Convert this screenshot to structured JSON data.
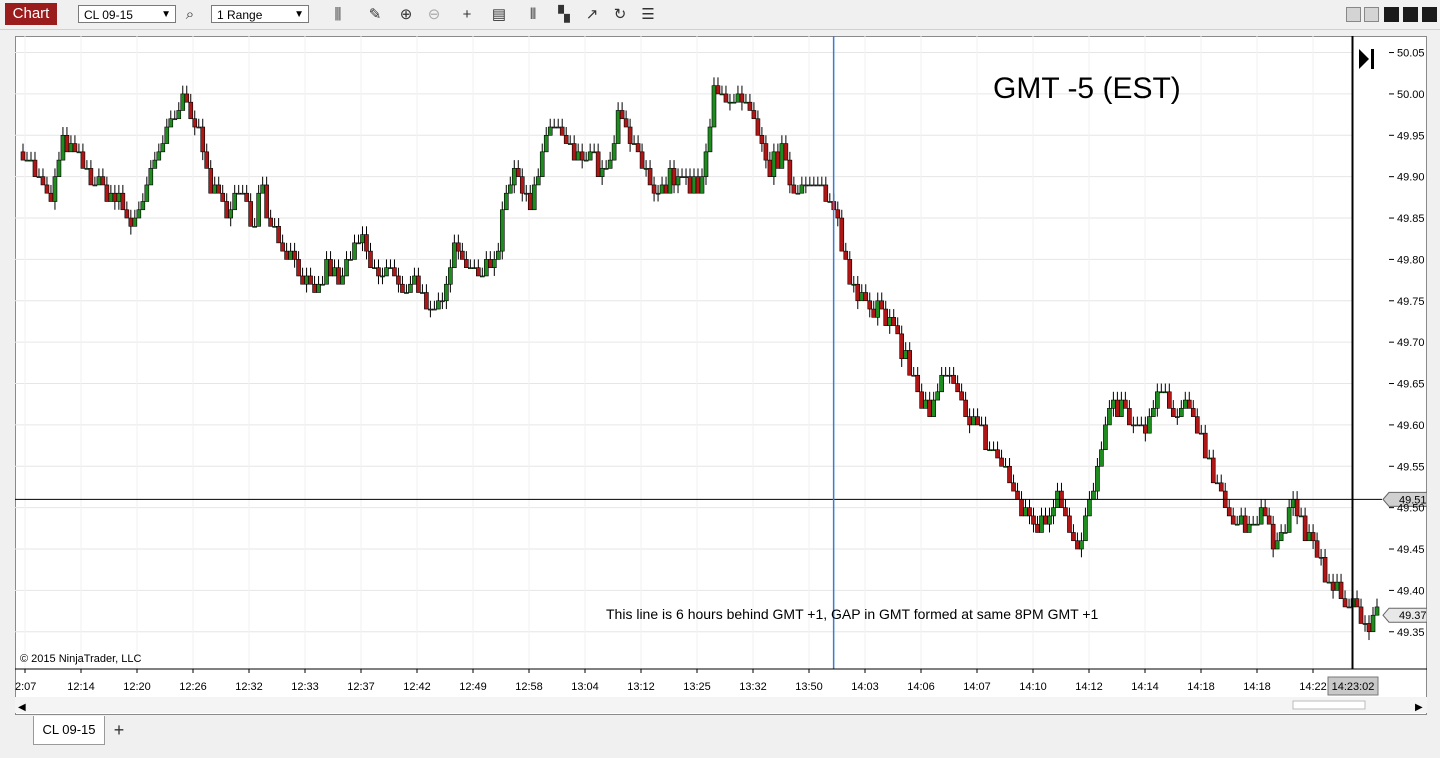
{
  "toolbar": {
    "chart_label": "Chart",
    "instrument": "CL 09-15",
    "interval": "1 Range",
    "icons": [
      "search-icon",
      "bar-style-icon",
      "pencil-icon",
      "zoom-in-icon",
      "zoom-out-icon",
      "crosshair-icon",
      "data-box-icon",
      "indicators-icon",
      "strategies-icon",
      "drawing-tools-icon",
      "refresh-icon",
      "properties-icon"
    ]
  },
  "window_controls": [
    "minimize",
    "maximize",
    "restore",
    "close"
  ],
  "tabs": {
    "active": "CL 09-15",
    "add_label": "+"
  },
  "chart_data": {
    "type": "candlestick",
    "annotation_title": "GMT -5  (EST)",
    "note": "This line is 6 hours behind GMT +1, GAP in GMT formed at same 8PM GMT +1",
    "copyright": "© 2015 NinjaTrader, LLC",
    "ylim": [
      49.305,
      50.07
    ],
    "y_ticks": [
      "50.05",
      "50.00",
      "49.95",
      "49.90",
      "49.85",
      "49.80",
      "49.75",
      "49.70",
      "49.65",
      "49.60",
      "49.55",
      "49.50",
      "49.45",
      "49.40",
      "49.35"
    ],
    "x_ticks": [
      "2:07",
      "12:14",
      "12:20",
      "12:26",
      "12:32",
      "12:33",
      "12:37",
      "12:42",
      "12:49",
      "12:58",
      "13:04",
      "13:12",
      "13:25",
      "13:32",
      "13:50",
      "14:03",
      "14:06",
      "14:07",
      "14:10",
      "14:12",
      "14:14",
      "14:18",
      "14:18",
      "14:22"
    ],
    "x_cursor_label": "14:23:02",
    "horizontal_line": {
      "value": 49.51,
      "label": "49.51"
    },
    "last_price": {
      "value": 49.37,
      "label": "49.37"
    },
    "vertical_marker_index": 0.5987,
    "close_path": [
      [
        0,
        49.93
      ],
      [
        0.02,
        49.87
      ],
      [
        0.03,
        49.94
      ],
      [
        0.045,
        49.91
      ],
      [
        0.06,
        49.88
      ],
      [
        0.07,
        49.87
      ],
      [
        0.08,
        49.84
      ],
      [
        0.095,
        49.9
      ],
      [
        0.105,
        49.95
      ],
      [
        0.115,
        49.98
      ],
      [
        0.12,
        50.0
      ],
      [
        0.13,
        49.95
      ],
      [
        0.14,
        49.88
      ],
      [
        0.15,
        49.86
      ],
      [
        0.16,
        49.88
      ],
      [
        0.17,
        49.84
      ],
      [
        0.175,
        49.9
      ],
      [
        0.18,
        49.86
      ],
      [
        0.19,
        49.82
      ],
      [
        0.2,
        49.8
      ],
      [
        0.21,
        49.77
      ],
      [
        0.215,
        49.75
      ],
      [
        0.225,
        49.79
      ],
      [
        0.235,
        49.77
      ],
      [
        0.24,
        49.8
      ],
      [
        0.25,
        49.82
      ],
      [
        0.26,
        49.78
      ],
      [
        0.27,
        49.79
      ],
      [
        0.28,
        49.76
      ],
      [
        0.29,
        49.78
      ],
      [
        0.3,
        49.72
      ],
      [
        0.31,
        49.76
      ],
      [
        0.32,
        49.83
      ],
      [
        0.33,
        49.78
      ],
      [
        0.34,
        49.79
      ],
      [
        0.35,
        49.8
      ],
      [
        0.355,
        49.88
      ],
      [
        0.365,
        49.9
      ],
      [
        0.375,
        49.87
      ],
      [
        0.385,
        49.93
      ],
      [
        0.39,
        49.97
      ],
      [
        0.4,
        49.94
      ],
      [
        0.41,
        49.92
      ],
      [
        0.42,
        49.93
      ],
      [
        0.43,
        49.89
      ],
      [
        0.44,
        49.97
      ],
      [
        0.45,
        49.94
      ],
      [
        0.46,
        49.9
      ],
      [
        0.47,
        49.88
      ],
      [
        0.48,
        49.9
      ],
      [
        0.49,
        49.89
      ],
      [
        0.5,
        49.88
      ],
      [
        0.505,
        49.93
      ],
      [
        0.51,
        50.02
      ],
      [
        0.52,
        49.98
      ],
      [
        0.53,
        49.99
      ],
      [
        0.54,
        49.96
      ],
      [
        0.55,
        49.91
      ],
      [
        0.56,
        49.93
      ],
      [
        0.57,
        49.88
      ],
      [
        0.58,
        49.9
      ],
      [
        0.59,
        49.88
      ],
      [
        0.6,
        49.85
      ],
      [
        0.605,
        49.82
      ],
      [
        0.61,
        49.77
      ],
      [
        0.62,
        49.76
      ],
      [
        0.63,
        49.74
      ],
      [
        0.64,
        49.72
      ],
      [
        0.65,
        49.69
      ],
      [
        0.66,
        49.64
      ],
      [
        0.67,
        49.61
      ],
      [
        0.675,
        49.63
      ],
      [
        0.68,
        49.66
      ],
      [
        0.69,
        49.63
      ],
      [
        0.7,
        49.61
      ],
      [
        0.71,
        49.58
      ],
      [
        0.72,
        49.56
      ],
      [
        0.73,
        49.53
      ],
      [
        0.735,
        49.5
      ],
      [
        0.745,
        49.49
      ],
      [
        0.75,
        49.47
      ],
      [
        0.76,
        49.5
      ],
      [
        0.765,
        49.52
      ],
      [
        0.775,
        49.47
      ],
      [
        0.78,
        49.45
      ],
      [
        0.785,
        49.49
      ],
      [
        0.795,
        49.55
      ],
      [
        0.8,
        49.6
      ],
      [
        0.81,
        49.63
      ],
      [
        0.82,
        49.59
      ],
      [
        0.83,
        49.6
      ],
      [
        0.84,
        49.64
      ],
      [
        0.85,
        49.61
      ],
      [
        0.86,
        49.62
      ],
      [
        0.87,
        49.59
      ],
      [
        0.875,
        49.56
      ],
      [
        0.885,
        49.52
      ],
      [
        0.895,
        49.48
      ],
      [
        0.905,
        49.47
      ],
      [
        0.915,
        49.51
      ],
      [
        0.925,
        49.45
      ],
      [
        0.935,
        49.49
      ],
      [
        0.94,
        49.5
      ],
      [
        0.945,
        49.47
      ],
      [
        0.955,
        49.45
      ],
      [
        0.965,
        49.4
      ],
      [
        0.975,
        49.39
      ],
      [
        0.985,
        49.38
      ],
      [
        0.99,
        49.35
      ],
      [
        1.0,
        49.37
      ]
    ]
  }
}
